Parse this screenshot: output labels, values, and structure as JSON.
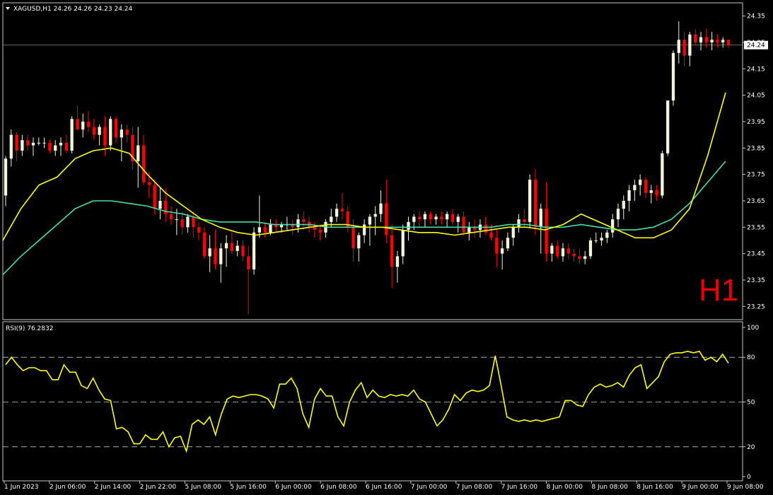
{
  "chart_data": [
    {
      "type": "candlestick",
      "symbol_header": "XAGUSD,H1",
      "ohlc_header": "24.26 24.26 24.23 24.24",
      "timeframe_label": "H1",
      "current_price_label": "24.24",
      "current_price": 24.24,
      "ylim": [
        23.2,
        24.4
      ],
      "y_ticks": [
        "24.35",
        "24.25",
        "24.15",
        "24.05",
        "23.95",
        "23.85",
        "23.75",
        "23.65",
        "23.55",
        "23.45",
        "23.35",
        "23.25"
      ],
      "x_ticks": [
        "1 Jun 2023",
        "2 Jun 06:00",
        "2 Jun 14:00",
        "2 Jun 22:00",
        "5 Jun 08:00",
        "5 Jun 16:00",
        "6 Jun 00:00",
        "6 Jun 08:00",
        "6 Jun 16:00",
        "7 Jun 00:00",
        "7 Jun 08:00",
        "7 Jun 16:00",
        "8 Jun 00:00",
        "8 Jun 08:00",
        "8 Jun 16:00",
        "9 Jun 00:00",
        "9 Jun 08:00"
      ],
      "bull_color": "#f5f5dc",
      "bear_color": "#ff0000",
      "candles": [
        [
          23.67,
          23.82,
          23.63,
          23.81
        ],
        [
          23.81,
          23.92,
          23.78,
          23.9
        ],
        [
          23.9,
          23.91,
          23.8,
          23.84
        ],
        [
          23.84,
          23.9,
          23.82,
          23.88
        ],
        [
          23.88,
          23.9,
          23.84,
          23.86
        ],
        [
          23.86,
          23.89,
          23.82,
          23.87
        ],
        [
          23.87,
          23.89,
          23.86,
          23.87
        ],
        [
          23.87,
          23.89,
          23.85,
          23.87
        ],
        [
          23.87,
          23.88,
          23.83,
          23.84
        ],
        [
          23.84,
          23.88,
          23.82,
          23.86
        ],
        [
          23.86,
          23.89,
          23.82,
          23.87
        ],
        [
          23.87,
          23.9,
          23.83,
          23.84
        ],
        [
          23.84,
          23.97,
          23.83,
          23.96
        ],
        [
          23.96,
          24.01,
          23.92,
          23.92
        ],
        [
          23.92,
          23.98,
          23.89,
          23.95
        ],
        [
          23.95,
          23.99,
          23.91,
          23.93
        ],
        [
          23.93,
          23.96,
          23.88,
          23.9
        ],
        [
          23.9,
          23.94,
          23.86,
          23.93
        ],
        [
          23.93,
          23.97,
          23.82,
          23.86
        ],
        [
          23.86,
          23.97,
          23.84,
          23.96
        ],
        [
          23.96,
          23.97,
          23.87,
          23.89
        ],
        [
          23.89,
          23.94,
          23.8,
          23.92
        ],
        [
          23.92,
          23.94,
          23.87,
          23.9
        ],
        [
          23.9,
          23.93,
          23.77,
          23.8
        ],
        [
          23.8,
          23.93,
          23.7,
          23.86
        ],
        [
          23.86,
          23.9,
          23.71,
          23.72
        ],
        [
          23.72,
          23.76,
          23.66,
          23.71
        ],
        [
          23.71,
          23.73,
          23.6,
          23.62
        ],
        [
          23.62,
          23.7,
          23.58,
          23.65
        ],
        [
          23.65,
          23.7,
          23.57,
          23.6
        ],
        [
          23.6,
          23.63,
          23.56,
          23.58
        ],
        [
          23.58,
          23.62,
          23.52,
          23.58
        ],
        [
          23.58,
          23.61,
          23.52,
          23.55
        ],
        [
          23.55,
          23.6,
          23.53,
          23.59
        ],
        [
          23.59,
          23.61,
          23.51,
          23.55
        ],
        [
          23.55,
          23.57,
          23.5,
          23.53
        ],
        [
          23.53,
          23.55,
          23.43,
          23.44
        ],
        [
          23.44,
          23.52,
          23.38,
          23.47
        ],
        [
          23.47,
          23.54,
          23.39,
          23.41
        ],
        [
          23.41,
          23.49,
          23.34,
          23.47
        ],
        [
          23.47,
          23.52,
          23.4,
          23.49
        ],
        [
          23.49,
          23.54,
          23.45,
          23.46
        ],
        [
          23.46,
          23.5,
          23.44,
          23.48
        ],
        [
          23.48,
          23.5,
          23.42,
          23.44
        ],
        [
          23.44,
          23.48,
          23.22,
          23.39
        ],
        [
          23.39,
          23.55,
          23.37,
          23.53
        ],
        [
          23.53,
          23.67,
          23.51,
          23.55
        ],
        [
          23.55,
          23.57,
          23.51,
          23.53
        ],
        [
          23.53,
          23.58,
          23.52,
          23.56
        ],
        [
          23.56,
          23.58,
          23.53,
          23.55
        ],
        [
          23.55,
          23.57,
          23.53,
          23.56
        ],
        [
          23.56,
          23.59,
          23.54,
          23.56
        ],
        [
          23.56,
          23.58,
          23.52,
          23.55
        ],
        [
          23.55,
          23.6,
          23.53,
          23.58
        ],
        [
          23.58,
          23.61,
          23.54,
          23.57
        ],
        [
          23.57,
          23.59,
          23.53,
          23.55
        ],
        [
          23.55,
          23.57,
          23.51,
          23.54
        ],
        [
          23.54,
          23.56,
          23.5,
          23.53
        ],
        [
          23.53,
          23.58,
          23.51,
          23.57
        ],
        [
          23.57,
          23.62,
          23.55,
          23.59
        ],
        [
          23.59,
          23.64,
          23.57,
          23.62
        ],
        [
          23.62,
          23.68,
          23.58,
          23.61
        ],
        [
          23.61,
          23.63,
          23.53,
          23.55
        ],
        [
          23.55,
          23.58,
          23.42,
          23.47
        ],
        [
          23.47,
          23.53,
          23.42,
          23.52
        ],
        [
          23.52,
          23.58,
          23.49,
          23.56
        ],
        [
          23.56,
          23.6,
          23.48,
          23.59
        ],
        [
          23.59,
          23.63,
          23.52,
          23.6
        ],
        [
          23.6,
          23.69,
          23.57,
          23.64
        ],
        [
          23.64,
          23.73,
          23.49,
          23.52
        ],
        [
          23.52,
          23.56,
          23.32,
          23.4
        ],
        [
          23.4,
          23.46,
          23.34,
          23.44
        ],
        [
          23.44,
          23.56,
          23.41,
          23.54
        ],
        [
          23.54,
          23.59,
          23.5,
          23.57
        ],
        [
          23.57,
          23.6,
          23.54,
          23.59
        ],
        [
          23.59,
          23.61,
          23.55,
          23.58
        ],
        [
          23.58,
          23.61,
          23.55,
          23.6
        ],
        [
          23.6,
          23.61,
          23.56,
          23.58
        ],
        [
          23.58,
          23.6,
          23.56,
          23.59
        ],
        [
          23.59,
          23.61,
          23.56,
          23.58
        ],
        [
          23.58,
          23.61,
          23.55,
          23.6
        ],
        [
          23.6,
          23.62,
          23.56,
          23.57
        ],
        [
          23.57,
          23.6,
          23.53,
          23.59
        ],
        [
          23.59,
          23.61,
          23.52,
          23.53
        ],
        [
          23.53,
          23.57,
          23.5,
          23.55
        ],
        [
          23.55,
          23.58,
          23.51,
          23.54
        ],
        [
          23.54,
          23.58,
          23.51,
          23.56
        ],
        [
          23.56,
          23.59,
          23.52,
          23.53
        ],
        [
          23.53,
          23.56,
          23.5,
          23.51
        ],
        [
          23.51,
          23.54,
          23.4,
          23.45
        ],
        [
          23.45,
          23.5,
          23.39,
          23.47
        ],
        [
          23.47,
          23.53,
          23.46,
          23.51
        ],
        [
          23.51,
          23.56,
          23.48,
          23.55
        ],
        [
          23.55,
          23.6,
          23.53,
          23.58
        ],
        [
          23.58,
          23.62,
          23.55,
          23.57
        ],
        [
          23.57,
          23.75,
          23.55,
          23.73
        ],
        [
          23.73,
          23.77,
          23.52,
          23.55
        ],
        [
          23.55,
          23.64,
          23.45,
          23.62
        ],
        [
          23.62,
          23.72,
          23.42,
          23.45
        ],
        [
          23.45,
          23.49,
          23.42,
          23.48
        ],
        [
          23.48,
          23.5,
          23.43,
          23.44
        ],
        [
          23.44,
          23.49,
          23.42,
          23.47
        ],
        [
          23.47,
          23.49,
          23.43,
          23.45
        ],
        [
          23.45,
          23.47,
          23.42,
          23.44
        ],
        [
          23.44,
          23.47,
          23.41,
          23.43
        ],
        [
          23.43,
          23.46,
          23.41,
          23.44
        ],
        [
          23.44,
          23.51,
          23.43,
          23.5
        ],
        [
          23.5,
          23.53,
          23.49,
          23.5
        ],
        [
          23.5,
          23.53,
          23.48,
          23.51
        ],
        [
          23.51,
          23.54,
          23.49,
          23.53
        ],
        [
          23.53,
          23.6,
          23.51,
          23.58
        ],
        [
          23.58,
          23.64,
          23.55,
          23.62
        ],
        [
          23.62,
          23.67,
          23.58,
          23.65
        ],
        [
          23.65,
          23.71,
          23.61,
          23.69
        ],
        [
          23.69,
          23.73,
          23.65,
          23.71
        ],
        [
          23.71,
          23.75,
          23.67,
          23.73
        ],
        [
          23.73,
          23.74,
          23.66,
          23.68
        ],
        [
          23.68,
          23.71,
          23.64,
          23.69
        ],
        [
          23.69,
          23.71,
          23.65,
          23.67
        ],
        [
          23.67,
          23.84,
          23.66,
          23.83
        ],
        [
          23.83,
          24.03,
          23.82,
          24.03
        ],
        [
          24.03,
          24.22,
          24.01,
          24.21
        ],
        [
          24.21,
          24.33,
          24.17,
          24.26
        ],
        [
          24.26,
          24.29,
          24.16,
          24.2
        ],
        [
          24.2,
          24.29,
          24.16,
          24.28
        ],
        [
          24.28,
          24.3,
          24.24,
          24.25
        ],
        [
          24.25,
          24.29,
          24.22,
          24.27
        ],
        [
          24.27,
          24.3,
          24.23,
          24.25
        ],
        [
          24.25,
          24.29,
          24.22,
          24.26
        ],
        [
          24.26,
          24.28,
          24.23,
          24.25
        ],
        [
          24.25,
          24.27,
          24.23,
          24.26
        ],
        [
          24.26,
          24.26,
          24.23,
          24.24
        ]
      ],
      "ma_fast_color": "#ffff00",
      "ma_slow_color": "#40e0b0",
      "ma_fast": [
        23.5,
        23.62,
        23.71,
        23.74,
        23.81,
        23.84,
        23.85,
        23.83,
        23.75,
        23.68,
        23.63,
        23.58,
        23.55,
        23.53,
        23.52,
        23.53,
        23.54,
        23.55,
        23.56,
        23.56,
        23.55,
        23.55,
        23.54,
        23.53,
        23.53,
        23.52,
        23.53,
        23.54,
        23.55,
        23.55,
        23.54,
        23.56,
        23.6,
        23.57,
        23.54,
        23.51,
        23.51,
        23.54,
        23.62,
        23.82,
        24.06
      ],
      "ma_slow": [
        23.37,
        23.44,
        23.5,
        23.56,
        23.62,
        23.65,
        23.65,
        23.64,
        23.63,
        23.61,
        23.6,
        23.58,
        23.57,
        23.57,
        23.57,
        23.56,
        23.56,
        23.56,
        23.55,
        23.55,
        23.55,
        23.55,
        23.55,
        23.55,
        23.55,
        23.55,
        23.55,
        23.55,
        23.56,
        23.56,
        23.55,
        23.55,
        23.56,
        23.55,
        23.54,
        23.54,
        23.55,
        23.58,
        23.64,
        23.72,
        23.8
      ]
    },
    {
      "type": "line",
      "label": "RSI(9) 76.2832",
      "ylim": [
        0,
        100
      ],
      "y_ticks": [
        "100",
        "80",
        "50",
        "20",
        "0"
      ],
      "levels": [
        80,
        50,
        20
      ],
      "color": "#ffff00",
      "values": [
        75,
        80,
        75,
        71,
        73,
        73,
        71,
        71,
        65,
        65,
        75,
        70,
        70,
        61,
        59,
        66,
        58,
        52,
        51,
        32,
        33,
        30,
        22,
        22,
        28,
        25,
        25,
        30,
        20,
        26,
        27,
        17,
        35,
        38,
        35,
        40,
        28,
        42,
        52,
        54,
        53,
        54,
        55,
        55,
        54,
        52,
        46,
        62,
        62,
        66,
        59,
        42,
        33,
        52,
        59,
        54,
        54,
        40,
        34,
        50,
        58,
        63,
        53,
        58,
        54,
        53,
        55,
        54,
        55,
        54,
        58,
        52,
        50,
        42,
        34,
        38,
        45,
        55,
        51,
        56,
        58,
        57,
        58,
        61,
        81,
        61,
        40,
        38,
        37,
        38,
        37,
        38,
        37,
        38,
        39,
        40,
        51,
        51,
        48,
        47,
        55,
        60,
        62,
        60,
        61,
        63,
        60,
        68,
        73,
        75,
        59,
        63,
        67,
        77,
        82,
        83,
        83,
        84,
        83,
        84,
        78,
        80,
        77,
        82,
        76
      ]
    }
  ]
}
